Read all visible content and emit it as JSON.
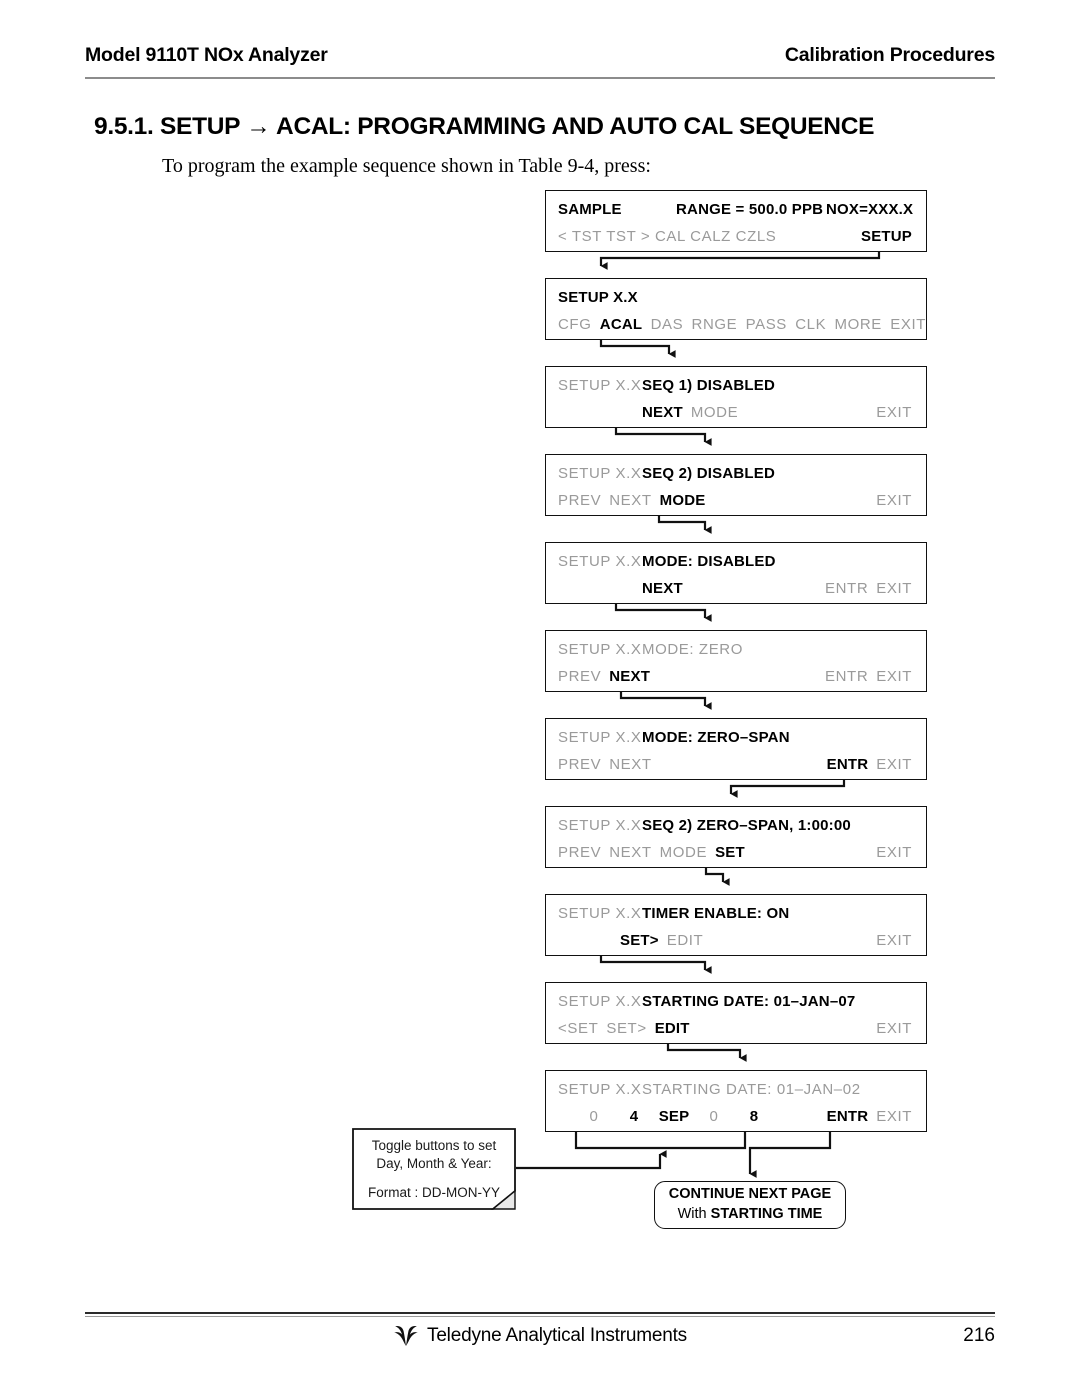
{
  "header": {
    "left": "Model 9110T NOx Analyzer",
    "right": "Calibration Procedures"
  },
  "section": {
    "title": "9.5.1. SETUP → ACAL: PROGRAMMING AND AUTO CAL SEQUENCE",
    "intro": "To program the example sequence shown in Table 9-4, press:"
  },
  "panels": [
    {
      "id": "sample",
      "line1": {
        "col1": "SAMPLE",
        "col2": "RANGE = 500.0 PPB",
        "col3": "NOX=XXX.X"
      },
      "line2_left": "< TST  TST >  CAL CALZ  CZLS",
      "line2_right": "SETUP"
    },
    {
      "id": "setup-menu",
      "prefix": "",
      "title": "SETUP X.X",
      "buttons": [
        "CFG",
        "ACAL",
        "DAS",
        "RNGE",
        "PASS",
        "CLK",
        "MORE",
        "EXIT"
      ],
      "active": "ACAL"
    },
    {
      "id": "seq1",
      "prefix": "SETUP X.X",
      "title": "SEQ 1) DISABLED",
      "left_buttons": [
        "NEXT",
        "MODE"
      ],
      "right_buttons": [
        "EXIT"
      ],
      "active": "NEXT"
    },
    {
      "id": "seq2",
      "prefix": "SETUP X.X",
      "title": "SEQ 2) DISABLED",
      "left_buttons": [
        "PREV",
        "NEXT",
        "MODE"
      ],
      "right_buttons": [
        "EXIT"
      ],
      "active": "MODE"
    },
    {
      "id": "mode-disabled",
      "prefix": "SETUP X.X",
      "title": "MODE: DISABLED",
      "left_buttons": [
        "NEXT"
      ],
      "right_buttons": [
        "ENTR",
        "EXIT"
      ],
      "active": "NEXT"
    },
    {
      "id": "mode-zero",
      "prefix": "SETUP X.X",
      "title": "MODE: ZERO",
      "title_dim": true,
      "left_buttons": [
        "PREV",
        "NEXT"
      ],
      "right_buttons": [
        "ENTR",
        "EXIT"
      ],
      "active": "NEXT"
    },
    {
      "id": "mode-zero-span",
      "prefix": "SETUP X.X",
      "title": "MODE: ZERO–SPAN",
      "left_buttons": [
        "PREV",
        "NEXT"
      ],
      "right_buttons": [
        "ENTR",
        "EXIT"
      ],
      "active": "ENTR"
    },
    {
      "id": "seq2-zero-span",
      "prefix": "SETUP X.X",
      "title": "SEQ 2) ZERO–SPAN,  1:00:00",
      "left_buttons": [
        "PREV",
        "NEXT",
        "MODE",
        "SET"
      ],
      "right_buttons": [
        "EXIT"
      ],
      "active": "SET"
    },
    {
      "id": "timer-enable",
      "prefix": "SETUP X.X",
      "title": "TIMER ENABLE: ON",
      "left_buttons": [
        "SET>",
        "EDIT"
      ],
      "right_buttons": [
        "EXIT"
      ],
      "active": "SET>"
    },
    {
      "id": "starting-date",
      "prefix": "SETUP X.X",
      "title": "STARTING DATE: 01–JAN–07",
      "left_buttons": [
        "<SET",
        "SET>",
        "EDIT"
      ],
      "right_buttons": [
        "EXIT"
      ],
      "active": "EDIT"
    },
    {
      "id": "starting-date-edit",
      "prefix": "SETUP X.X",
      "title": "STARTING DATE: 01–JAN–02",
      "title_dim": true,
      "digits": [
        {
          "value": "0",
          "active": false
        },
        {
          "value": "4",
          "active": true
        },
        {
          "value": "SEP",
          "active": true
        },
        {
          "value": "0",
          "active": false
        },
        {
          "value": "8",
          "active": true
        }
      ],
      "right_buttons": [
        "ENTR",
        "EXIT"
      ],
      "active": "ENTR"
    }
  ],
  "note": {
    "line1": "Toggle buttons to set",
    "line2": "Day, Month & Year:",
    "line3": "Format : DD-MON-YY"
  },
  "continue_box": {
    "line1": "CONTINUE NEXT PAGE",
    "line2_prefix": "With ",
    "line2_bold": "STARTING TIME"
  },
  "footer": {
    "company": "Teledyne Analytical Instruments",
    "page": "216"
  }
}
